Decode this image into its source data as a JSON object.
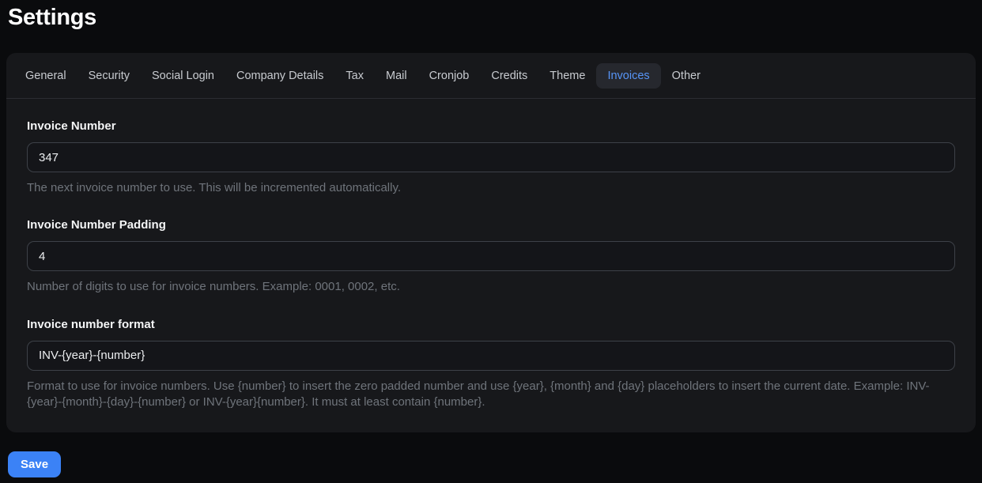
{
  "page": {
    "title": "Settings"
  },
  "tabs": {
    "items": [
      {
        "label": "General",
        "active": false
      },
      {
        "label": "Security",
        "active": false
      },
      {
        "label": "Social Login",
        "active": false
      },
      {
        "label": "Company Details",
        "active": false
      },
      {
        "label": "Tax",
        "active": false
      },
      {
        "label": "Mail",
        "active": false
      },
      {
        "label": "Cronjob",
        "active": false
      },
      {
        "label": "Credits",
        "active": false
      },
      {
        "label": "Theme",
        "active": false
      },
      {
        "label": "Invoices",
        "active": true
      },
      {
        "label": "Other",
        "active": false
      }
    ]
  },
  "form": {
    "fields": [
      {
        "label": "Invoice Number",
        "value": "347",
        "help": "The next invoice number to use. This will be incremented automatically."
      },
      {
        "label": "Invoice Number Padding",
        "value": "4",
        "help": "Number of digits to use for invoice numbers. Example: 0001, 0002, etc."
      },
      {
        "label": "Invoice number format",
        "value": "INV-{year}-{number}",
        "help": "Format to use for invoice numbers. Use {number} to insert the zero padded number and use {year}, {month} and {day} placeholders to insert the current date. Example: INV-{year}-{month}-{day}-{number} or INV-{year}{number}. It must at least contain {number}."
      }
    ],
    "save_label": "Save"
  },
  "colors": {
    "accent": "#3b82f6",
    "active_tab_text": "#5795f7",
    "card_background": "#17181b",
    "page_background": "#0a0b0d"
  }
}
